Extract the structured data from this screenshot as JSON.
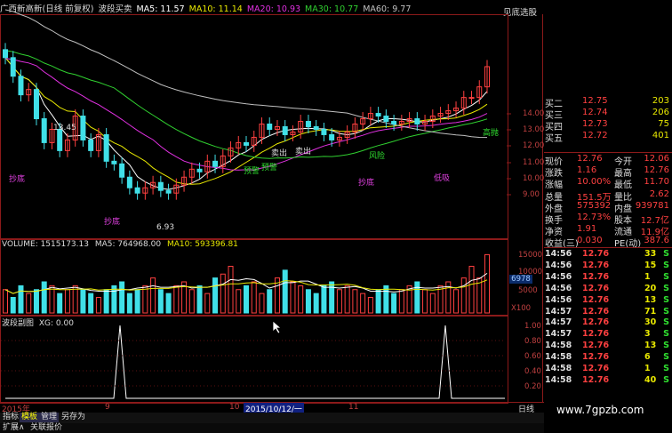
{
  "header": {
    "title": "广西新高新(日线 前复权)",
    "indicator_name": "波段买卖",
    "ma": [
      {
        "label": "MA5: 11.57",
        "color": "#ffffff"
      },
      {
        "label": "MA10: 11.14",
        "color": "#e8e800"
      },
      {
        "label": "MA20: 10.93",
        "color": "#e030e0"
      },
      {
        "label": "MA30: 10.77",
        "color": "#30d030"
      },
      {
        "label": "MA60: 9.77",
        "color": "#c0c0c0"
      }
    ],
    "right_label": "见底选股"
  },
  "price_panel": {
    "axis": [
      "14.00",
      "13.00",
      "12.00",
      "11.00",
      "10.00",
      "9.00"
    ],
    "annotations": {
      "high": "13.45",
      "low": "6.93",
      "buy_signals": [
        "抄底",
        "抄底",
        "抄底",
        "低吸",
        "抄底"
      ],
      "sell_signals": [
        "卖出",
        "卖出",
        "风险",
        "高抛"
      ],
      "cross_labels": [
        "预警",
        "预警"
      ]
    },
    "close_prices": [
      13.1,
      12.4,
      11.7,
      11.9,
      10.8,
      9.9,
      10.4,
      9.6,
      10.0,
      10.9,
      10.0,
      9.6,
      10.2,
      9.2,
      9.1,
      8.6,
      8.2,
      8.0,
      8.2,
      8.4,
      8.1,
      8.0,
      8.3,
      8.6,
      8.9,
      8.8,
      9.2,
      9.0,
      9.4,
      9.7,
      9.9,
      9.8,
      10.1,
      10.6,
      10.4,
      10.5,
      10.2,
      10.3,
      10.7,
      10.5,
      10.4,
      10.2,
      10.0,
      10.1,
      10.3,
      10.6,
      10.8,
      11.0,
      10.9,
      10.7,
      10.6,
      10.7,
      10.8,
      10.6,
      10.7,
      10.9,
      11.0,
      11.1,
      11.2,
      11.6,
      11.6,
      12.0,
      12.76
    ]
  },
  "volume_panel": {
    "label": "VOLUME: 1515173.13",
    "ma5": "MA5: 764968.00",
    "ma10": "MA10: 593396.81",
    "axis": [
      "15000",
      "10000",
      "6978",
      "5000",
      "X100"
    ],
    "current_box": "6978",
    "volumes": [
      6,
      4,
      7,
      5,
      6,
      8,
      7,
      5,
      6,
      7,
      6,
      5,
      4,
      6,
      7,
      8,
      5,
      6,
      7,
      9,
      6,
      5,
      7,
      8,
      6,
      7,
      5,
      9,
      10,
      12,
      6,
      7,
      8,
      5,
      6,
      9,
      11,
      8,
      7,
      6,
      5,
      7,
      8,
      6,
      7,
      6,
      5,
      4,
      6,
      7,
      5,
      6,
      7,
      8,
      6,
      5,
      7,
      8,
      6,
      9,
      12,
      9,
      15
    ]
  },
  "indicator_panel": {
    "label": "波段副图",
    "xg": "XG: 0.00",
    "axis": [
      "1.00",
      "0.80",
      "0.60",
      "0.40",
      "0.20"
    ]
  },
  "date_axis": {
    "labels": [
      "2015年",
      "9",
      "10",
      "2015/10/12/一",
      "11"
    ],
    "right": "日线"
  },
  "order_book": [
    {
      "name": "买二",
      "price": "12.75",
      "vol": "203"
    },
    {
      "name": "买三",
      "price": "12.74",
      "vol": "206"
    },
    {
      "name": "买四",
      "price": "12.73",
      "vol": "75"
    },
    {
      "name": "买五",
      "price": "12.72",
      "vol": "401"
    }
  ],
  "stats": [
    {
      "k1": "现价",
      "v1": "12.76",
      "k2": "今开",
      "v2": "12.06"
    },
    {
      "k1": "涨跌",
      "v1": "1.16",
      "k2": "最高",
      "v2": "12.76"
    },
    {
      "k1": "涨幅",
      "v1": "10.00%",
      "k2": "最低",
      "v2": "11.70"
    },
    {
      "k1": "总量",
      "v1": "151.5万",
      "k2": "量比",
      "v2": "2.62"
    },
    {
      "k1": "外盘",
      "v1": "575392",
      "k2": "内盘",
      "v2": "939781"
    },
    {
      "k1": "换手",
      "v1": "12.73%",
      "k2": "股本",
      "v2": "12.7亿"
    },
    {
      "k1": "净资",
      "v1": "1.91",
      "k2": "流通",
      "v2": "11.9亿"
    },
    {
      "k1": "收益(三)",
      "v1": "0.030",
      "k2": "PE(动)",
      "v2": "387.6"
    }
  ],
  "ticks": [
    {
      "time": "14:56",
      "price": "12.76",
      "vol": "33",
      "dir": "S"
    },
    {
      "time": "14:56",
      "price": "12.76",
      "vol": "15",
      "dir": "S"
    },
    {
      "time": "14:56",
      "price": "12.76",
      "vol": "1",
      "dir": "S"
    },
    {
      "time": "14:56",
      "price": "12.76",
      "vol": "20",
      "dir": "S"
    },
    {
      "time": "14:56",
      "price": "12.76",
      "vol": "13",
      "dir": "S"
    },
    {
      "time": "14:57",
      "price": "12.76",
      "vol": "71",
      "dir": "S"
    },
    {
      "time": "14:57",
      "price": "12.76",
      "vol": "30",
      "dir": "S"
    },
    {
      "time": "14:57",
      "price": "12.76",
      "vol": "3",
      "dir": "S"
    },
    {
      "time": "14:58",
      "price": "12.76",
      "vol": "13",
      "dir": "S"
    },
    {
      "time": "14:58",
      "price": "12.76",
      "vol": "6",
      "dir": "S"
    },
    {
      "time": "14:58",
      "price": "12.76",
      "vol": "1",
      "dir": "S"
    },
    {
      "time": "14:58",
      "price": "12.76",
      "vol": "40",
      "dir": "S"
    }
  ],
  "bottom_tabs": [
    "指标",
    "模板",
    "管理",
    "另存为"
  ],
  "bottom_tabs2": [
    "扩展∧",
    "关联报价"
  ],
  "watermark": "www.7gpzb.com",
  "colors": {
    "up": "#ff4040",
    "down": "#40e0e8",
    "grid": "#8c1a1a",
    "text": "#c0c0c0"
  }
}
